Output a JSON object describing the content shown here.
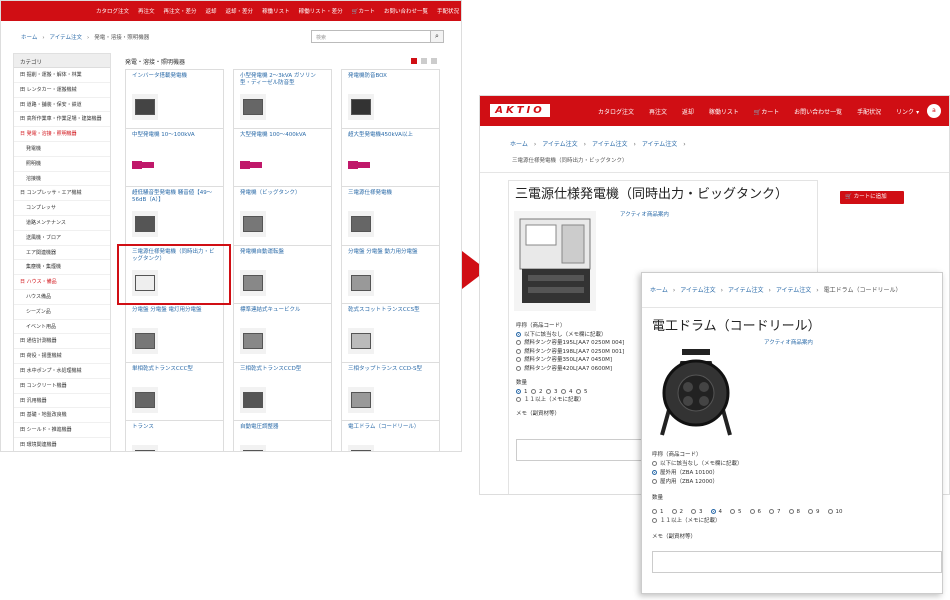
{
  "left": {
    "topnav": [
      "カタログ注文",
      "再注文",
      "再注文・差分",
      "返却",
      "返却・差分",
      "稼働リスト",
      "稼働リスト・差分",
      "カート",
      "お問い合わせ一覧",
      "手配状況"
    ],
    "breadcrumb": [
      "ホーム",
      "アイテム注文",
      "発電・溶接・照明機器"
    ],
    "search_placeholder": "検索",
    "sidebar_title": "カテゴリ",
    "sidebar": [
      {
        "label": "田 掘削・運搬・解体・林業",
        "sub": false,
        "active": false
      },
      {
        "label": "田 レンタカー・運搬機械",
        "sub": false,
        "active": false
      },
      {
        "label": "田 道路・舗装・保安・鉄道",
        "sub": false,
        "active": false
      },
      {
        "label": "田 高所作業車・作業足場・建築機器",
        "sub": false,
        "active": false
      },
      {
        "label": "日 発電・溶接・照明機器",
        "sub": false,
        "active": true
      },
      {
        "label": "発電機",
        "sub": true,
        "active": false
      },
      {
        "label": "照明機",
        "sub": true,
        "active": false
      },
      {
        "label": "溶接機",
        "sub": true,
        "active": false
      },
      {
        "label": "日 コンプレッサ・エア機械",
        "sub": false,
        "active": false
      },
      {
        "label": "コンプレッサ",
        "sub": true,
        "active": false
      },
      {
        "label": "道路メンテナンス",
        "sub": true,
        "active": false
      },
      {
        "label": "送風機・ブロア",
        "sub": true,
        "active": false
      },
      {
        "label": "エア関連機器",
        "sub": true,
        "active": false
      },
      {
        "label": "集塵機・集煙機",
        "sub": true,
        "active": false
      },
      {
        "label": "日 ハウス・備品",
        "sub": false,
        "active": true
      },
      {
        "label": "ハウス備品",
        "sub": true,
        "active": false
      },
      {
        "label": "シーズン品",
        "sub": true,
        "active": false
      },
      {
        "label": "イベント用品",
        "sub": true,
        "active": false
      },
      {
        "label": "田 通信計測機器",
        "sub": false,
        "active": false
      },
      {
        "label": "田 荷役・揚重機械",
        "sub": false,
        "active": false
      },
      {
        "label": "田 水中ポンプ・水処理機械",
        "sub": false,
        "active": false
      },
      {
        "label": "田 コンクリート機器",
        "sub": false,
        "active": false
      },
      {
        "label": "田 汎用機器",
        "sub": false,
        "active": false
      },
      {
        "label": "田 基礎・地盤改良機",
        "sub": false,
        "active": false
      },
      {
        "label": "田 シールド・推進機器",
        "sub": false,
        "active": false
      },
      {
        "label": "田 環境関連機器",
        "sub": false,
        "active": false
      }
    ],
    "products_heading": "発電・溶接・照明機器",
    "products": [
      "インバータ搭載発電機",
      "小型発電機 2～3kVA ガソリン型・ディーゼル防音型",
      "発電機防音BOX",
      "中型発電機 10～100kVA",
      "大型発電機 100～400kVA",
      "超大型発電機450kVA以上",
      "超低騒音型発電機 騒音値【49～56dB（A）】",
      "発電機（ビッグタンク）",
      "三電源仕様発電機",
      "三電源仕様発電機（同時出力・ビッグタンク）",
      "発電機自動運転盤",
      "分電盤 分電盤 動力用分電盤",
      "分電盤 分電盤 電灯用分電盤",
      "標準連結式キュービクル",
      "乾式スコットトランスCCS型",
      "単相乾式トランスCCC型",
      "三相乾式トランスCCD型",
      "三相タップトランス CCD-S型",
      "トランス",
      "自動電圧調整器",
      "電工ドラム（コードリール）"
    ]
  },
  "right": {
    "logo": "AKTIO",
    "nav": [
      "カタログ注文",
      "再注文",
      "返却",
      "稼働リスト",
      "カート",
      "お問い合わせ一覧",
      "手配状況",
      "リンク"
    ],
    "avatar": "a",
    "breadcrumb": [
      "ホーム",
      "アイテム注文",
      "アイテム注文",
      "アイテム注文"
    ],
    "subtitle": "三電源仕様発電機（同時出力・ビッグタンク）",
    "title": "三電源仕様発電機（同時出力・ビッグタンク）",
    "guide_link": "アクティオ商品案内",
    "cart_button": "カートに追加",
    "form_label_product": "呼称（商品コード）",
    "options": [
      "以下に該当なし（メモ欄に記載）",
      "燃料タンク容量195L[AA7 0250M 004]",
      "燃料タンク容量198L[AA7 0250M 001]",
      "燃料タンク容量350L[AA7 0450M]",
      "燃料タンク容量420L[AA7 0600M]"
    ],
    "qty_label": "数量",
    "qty": [
      "1",
      "2",
      "3",
      "4",
      "5"
    ],
    "qty_more": "１１以上（メモに記載）",
    "memo_label": "メモ（副資材等）"
  },
  "popup": {
    "breadcrumb": [
      "ホーム",
      "アイテム注文",
      "アイテム注文",
      "アイテム注文",
      "電工ドラム（コードリール）"
    ],
    "title": "電工ドラム（コードリール）",
    "guide_link": "アクティオ商品案内",
    "form_label_product": "呼称（商品コード）",
    "options": [
      "以下に該当なし（メモ欄に記載）",
      "屋外用（ZBA 10100）",
      "屋内用（ZBA 12000）"
    ],
    "qty_label": "数量",
    "qty": [
      "1",
      "2",
      "3",
      "4",
      "5",
      "6",
      "7",
      "8",
      "9",
      "10"
    ],
    "qty_more": "１１以上（メモに記載）",
    "memo_label": "メモ（副資材等）"
  },
  "colors": {
    "brand_red": "#d00e14",
    "link_blue": "#2a6aa8"
  }
}
